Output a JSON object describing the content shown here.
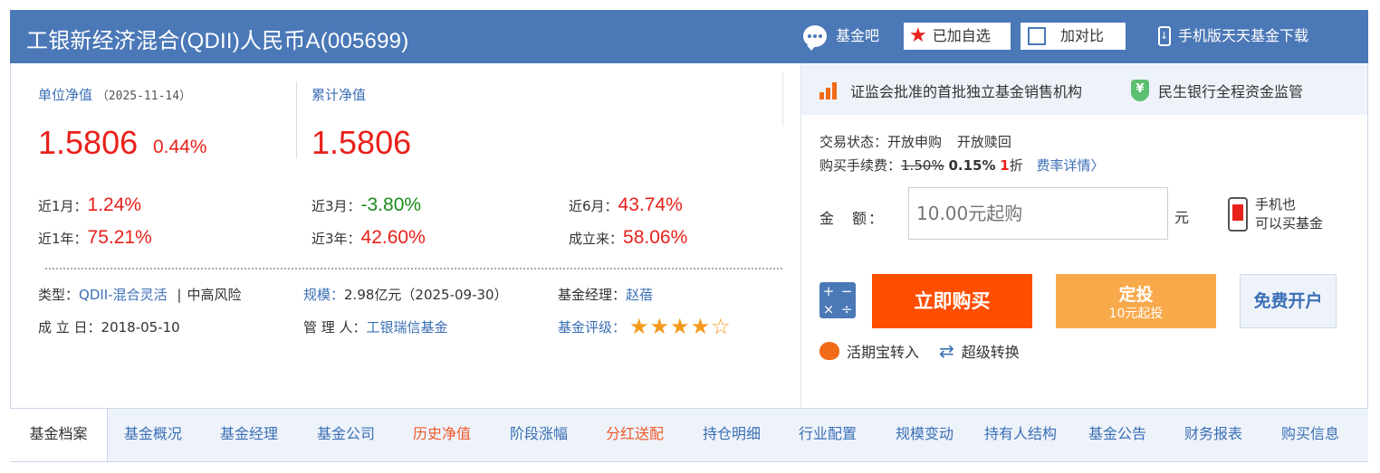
{
  "header": {
    "title": "工银新经济混合(QDII)人民币A(005699)",
    "fund_bar": "基金吧",
    "added": "已加自选",
    "compare": "加对比",
    "mobile": "手机版天天基金下载"
  },
  "nav": {
    "unit_label": "单位净值",
    "unit_date": "（2025-11-14）",
    "unit_value": "1.5806",
    "unit_change": "0.44%",
    "acc_label": "累计净值",
    "acc_value": "1.5806"
  },
  "performance": [
    {
      "label": "近1月：",
      "value": "1.24%",
      "color": "#e8211a"
    },
    {
      "label": "近3月：",
      "value": "-3.80%",
      "color": "#1a8c1a"
    },
    {
      "label": "近6月：",
      "value": "43.74%",
      "color": "#e8211a"
    },
    {
      "label": "近1年：",
      "value": "75.21%",
      "color": "#e8211a"
    },
    {
      "label": "近3年：",
      "value": "42.60%",
      "color": "#e8211a"
    },
    {
      "label": "成立来：",
      "value": "58.06%",
      "color": "#e8211a"
    }
  ],
  "info": {
    "type_label": "类型：",
    "type_value": "QDII-混合灵活",
    "sep": "|",
    "risk": "中高风险",
    "scale_label": "规模：",
    "scale_value": "2.98亿元（2025-09-30）",
    "manager_label": "基金经理：",
    "manager_value": "赵蓓",
    "inception_label": "成 立 日：",
    "inception_value": "2018-05-10",
    "admin_label": "管 理 人：",
    "admin_value": "工银瑞信基金",
    "rating_label": "基金评级：",
    "rating": 4,
    "rating_max": 5
  },
  "trust": {
    "item1": "证监会批准的首批独立基金销售机构",
    "item2": "民生银行全程资金监管"
  },
  "trade": {
    "status_label": "交易状态：",
    "status_buy": "开放申购",
    "status_redeem": "开放赎回",
    "fee_label": "购买手续费：",
    "fee_original": "1.50%",
    "fee_now": "0.15%",
    "fee_discount_num": "1",
    "fee_discount_unit": "折",
    "fee_detail": "费率详情〉",
    "amount_label": "金　额：",
    "amount_placeholder": "10.00元起购",
    "amount_unit": "元",
    "mobile_line1": "手机也",
    "mobile_line2": "可以买基金",
    "buy_button": "立即购买",
    "sip_button": "定投",
    "sip_sub": "10元起投",
    "open_button": "免费开户",
    "huoqibao": "活期宝转入",
    "super_switch": "超级转换"
  },
  "bottom_nav": {
    "first": "基金档案",
    "items": [
      "基金概况",
      "基金经理",
      "基金公司",
      "历史净值",
      "阶段涨幅",
      "分红送配",
      "持仓明细",
      "行业配置",
      "规模变动",
      "持有人结构",
      "基金公告",
      "财务报表",
      "购买信息"
    ]
  },
  "colors": {
    "brand": "#4b78b7",
    "up": "#e8211a",
    "down": "#1a8c1a",
    "buy": "#ff4e00",
    "sip": "#f8a94a",
    "highlight_nav": "#f0582a"
  }
}
